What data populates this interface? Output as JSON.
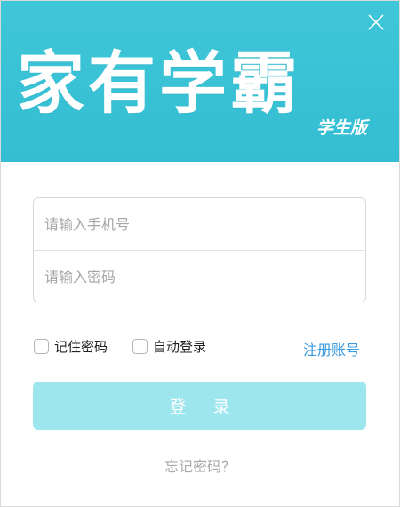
{
  "header": {
    "logo_text": "家有学霸",
    "logo_subtitle": "学生版",
    "close_icon": "close-icon",
    "background_color": "#3cc4d7"
  },
  "form": {
    "phone_placeholder": "请输入手机号",
    "password_placeholder": "请输入密码"
  },
  "options": {
    "remember_password_label": "记住密码",
    "remember_password_checked": false,
    "auto_login_label": "自动登录",
    "auto_login_checked": false,
    "register_link": "注册账号",
    "link_color": "#3a9be0"
  },
  "actions": {
    "login_label": "登 录",
    "login_color": "#9ee6ee",
    "forgot_password_link": "忘记密码？"
  }
}
